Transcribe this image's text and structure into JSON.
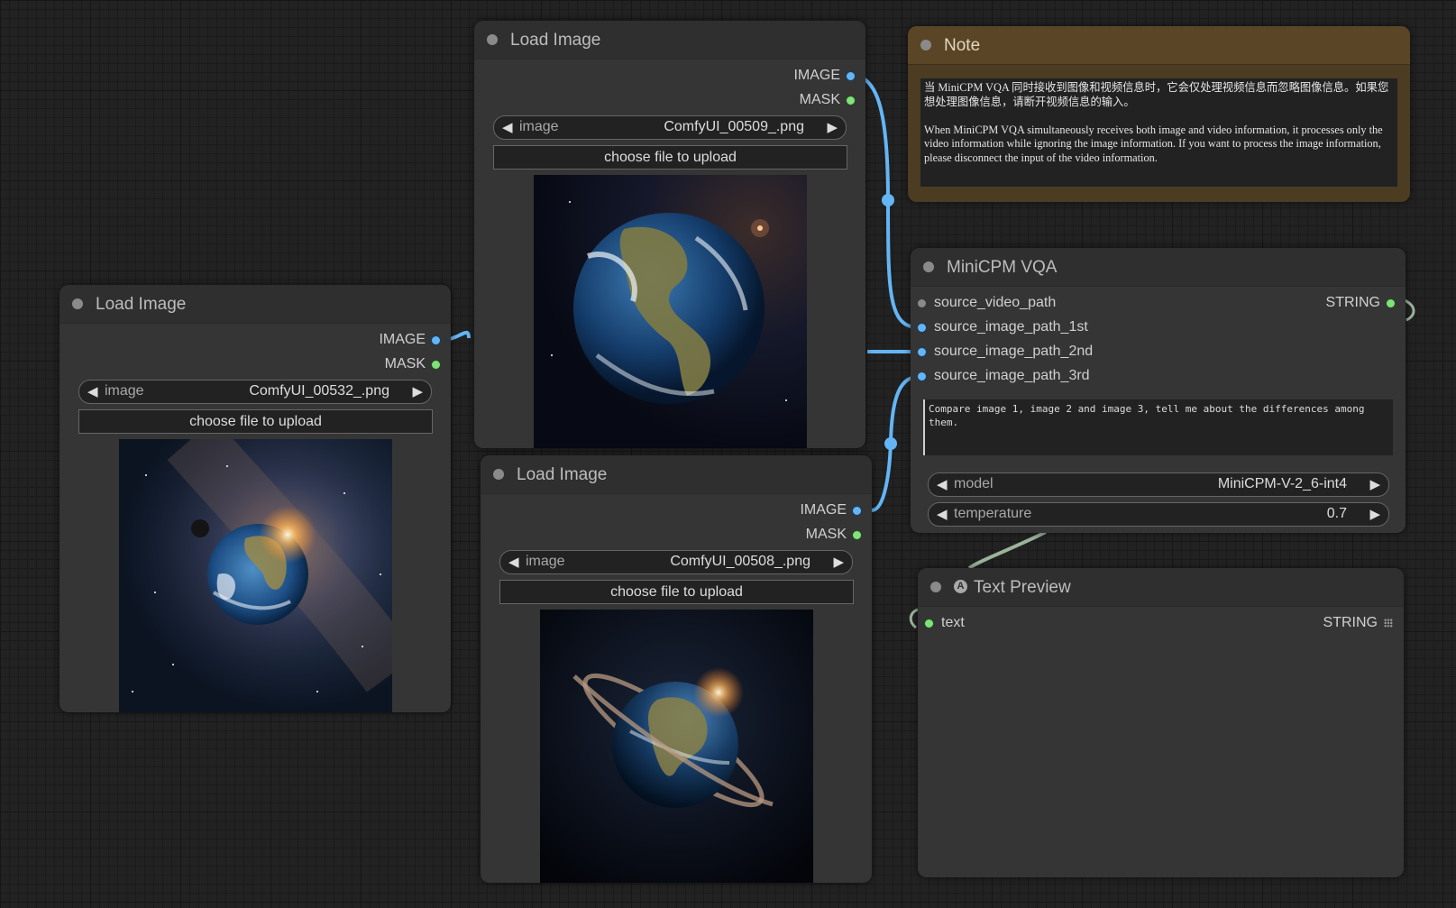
{
  "canvas": {
    "background": "#222222",
    "wire_color": "#64b5f6"
  },
  "nodes": {
    "load_image_left": {
      "title": "Load Image",
      "outputs": [
        "IMAGE",
        "MASK"
      ],
      "image_widget": {
        "label": "image",
        "value": "ComfyUI_00532_.png"
      },
      "upload_label": "choose file to upload"
    },
    "load_image_top": {
      "title": "Load Image",
      "outputs": [
        "IMAGE",
        "MASK"
      ],
      "image_widget": {
        "label": "image",
        "value": "ComfyUI_00509_.png"
      },
      "upload_label": "choose file to upload"
    },
    "load_image_bottom": {
      "title": "Load Image",
      "outputs": [
        "IMAGE",
        "MASK"
      ],
      "image_widget": {
        "label": "image",
        "value": "ComfyUI_00508_.png"
      },
      "upload_label": "choose file to upload"
    },
    "note": {
      "title": "Note",
      "text": "当 MiniCPM VQA 同时接收到图像和视频信息时，它会仅处理视频信息而忽略图像信息。如果您想处理图像信息，请断开视频信息的输入。\n\nWhen MiniCPM VQA simultaneously receives both image and video information, it processes only the video information while ignoring the image information. If you want to process the image information, please disconnect the input of the video information."
    },
    "minicpm": {
      "title": "MiniCPM VQA",
      "inputs": [
        "source_video_path",
        "source_image_path_1st",
        "source_image_path_2nd",
        "source_image_path_3rd"
      ],
      "output": "STRING",
      "prompt": "Compare image 1, image 2 and image 3, tell me about the differences among them.",
      "model": {
        "label": "model",
        "value": "MiniCPM-V-2_6-int4"
      },
      "temperature": {
        "label": "temperature",
        "value": "0.7"
      }
    },
    "text_preview": {
      "title": "Text Preview",
      "title_icon": "A",
      "input": "text",
      "output": "STRING"
    }
  }
}
